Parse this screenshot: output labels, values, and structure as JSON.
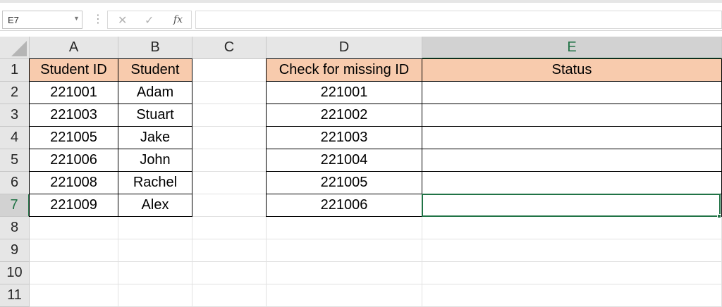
{
  "formula_bar": {
    "name_box": "E7",
    "name_box_arrow_icon": "chevron-down-icon",
    "separator": "⋮",
    "cancel_glyph": "✕",
    "enter_glyph": "✓",
    "function_glyph": "fx",
    "formula_value": ""
  },
  "grid": {
    "columns": [
      "A",
      "B",
      "C",
      "D",
      "E"
    ],
    "rows": [
      "1",
      "2",
      "3",
      "4",
      "5",
      "6",
      "7",
      "8",
      "9",
      "10",
      "11"
    ],
    "active_cell": "E7",
    "header_fill_color": "#f8cbad",
    "selection_color": "#217346"
  },
  "sheet": {
    "table1": {
      "headers": [
        "Student ID",
        "Student"
      ],
      "rows": [
        [
          "221001",
          "Adam"
        ],
        [
          "221003",
          "Stuart"
        ],
        [
          "221005",
          "Jake"
        ],
        [
          "221006",
          "John"
        ],
        [
          "221008",
          "Rachel"
        ],
        [
          "221009",
          "Alex"
        ]
      ]
    },
    "table2": {
      "headers": [
        "Check for missing ID",
        "Status"
      ],
      "rows": [
        [
          "221001",
          ""
        ],
        [
          "221002",
          ""
        ],
        [
          "221003",
          ""
        ],
        [
          "221004",
          ""
        ],
        [
          "221005",
          ""
        ],
        [
          "221006",
          ""
        ]
      ]
    }
  }
}
